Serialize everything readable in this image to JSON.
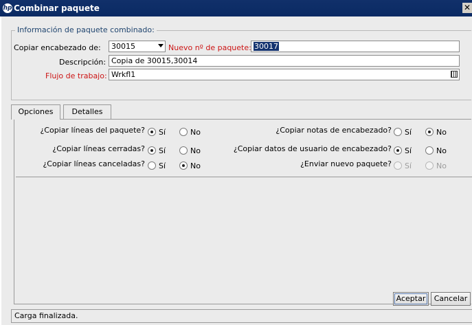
{
  "window": {
    "title": "Combinar paquete",
    "logo": "hp",
    "close_label": "✕"
  },
  "group": {
    "title": "Información de paquete combinado:",
    "copy_header_label": "Copiar encabezado de:",
    "copy_header_value": "30015",
    "new_package_label": "Nuevo nº de paquete:",
    "new_package_value": "30017",
    "description_label": "Descripción:",
    "description_value": "Copia de 30015,30014",
    "workflow_label": "Flujo de trabajo:",
    "workflow_value": "Wrkfl1"
  },
  "tabs": [
    {
      "label": "Opciones",
      "active": true
    },
    {
      "label": "Detalles",
      "active": false
    }
  ],
  "options": {
    "yes_label": "Sí",
    "no_label": "No",
    "copy_lines": {
      "label": "¿Copiar líneas del paquete?",
      "value": "Sí"
    },
    "copy_closed": {
      "label": "¿Copiar líneas cerradas?",
      "value": "Sí"
    },
    "copy_canceled": {
      "label": "¿Copiar líneas canceladas?",
      "value": "No"
    },
    "copy_notes": {
      "label": "¿Copiar notas de encabezado?",
      "value": "No"
    },
    "copy_user_data": {
      "label": "¿Copiar datos de usuario de encabezado?",
      "value": "Sí"
    },
    "send_new": {
      "label": "¿Enviar nuevo paquete?",
      "value": "",
      "disabled": true
    }
  },
  "buttons": {
    "accept": "Aceptar",
    "cancel": "Cancelar"
  },
  "status": {
    "text": "Carga finalizada."
  },
  "icons": {
    "combo_arrow": "chevron-down-icon",
    "lookup": "lookup-icon"
  },
  "colors": {
    "titlebar": "#0a2a63",
    "required_label": "#cc1515",
    "group_title": "#20456f",
    "selection": "#14336f"
  }
}
